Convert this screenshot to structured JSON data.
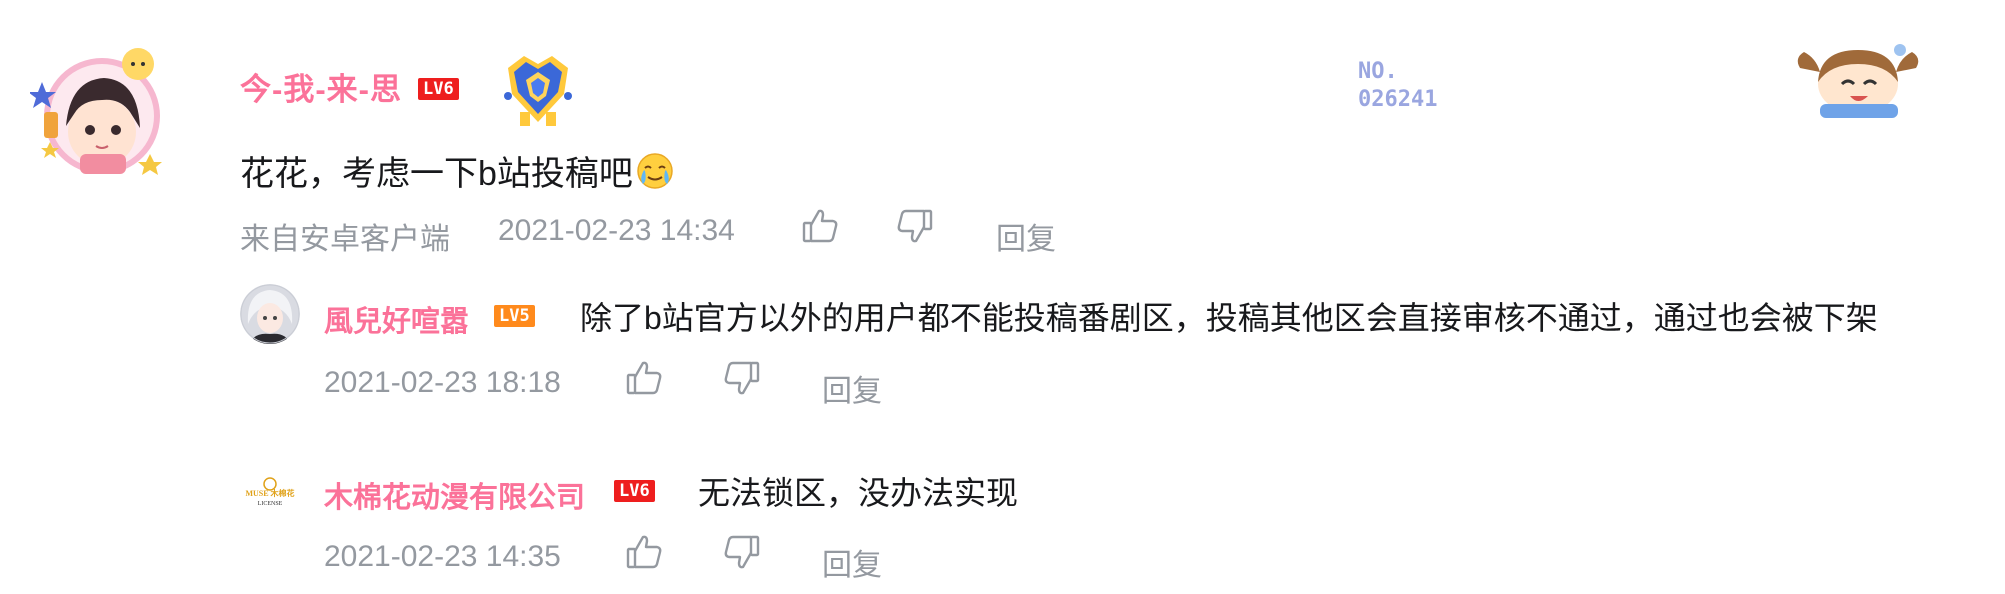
{
  "main_comment": {
    "username": "今-我-来-思",
    "level": "LV6",
    "fan_number": "NO.\n026241",
    "text": "花花，考虑一下b站投稿吧",
    "emoji": "crying-laugh-emoji",
    "source": "来自安卓客户端",
    "time": "2021-02-23 14:34",
    "reply_label": "回复"
  },
  "replies": [
    {
      "username": "風兒好喧嚣",
      "level": "LV5",
      "text": "除了b站官方以外的用户都不能投稿番剧区，投稿其他区会直接审核不通过，通过也会被下架",
      "time": "2021-02-23 18:18",
      "reply_label": "回复"
    },
    {
      "username": "木棉花动漫有限公司",
      "level": "LV6",
      "text": "无法锁区，没办法实现",
      "time": "2021-02-23 14:35",
      "reply_label": "回复",
      "avatar_logo_text": "MUSE 木棉花 LICENSE"
    }
  ],
  "icons": [
    "thumbs-up-icon",
    "thumbs-down-icon"
  ],
  "colors": {
    "username": "#fb7299",
    "meta": "#9499a0",
    "lv6": "#ee1e1e",
    "lv5": "#ff8a1c",
    "fan_no": "#9aa6e0"
  }
}
